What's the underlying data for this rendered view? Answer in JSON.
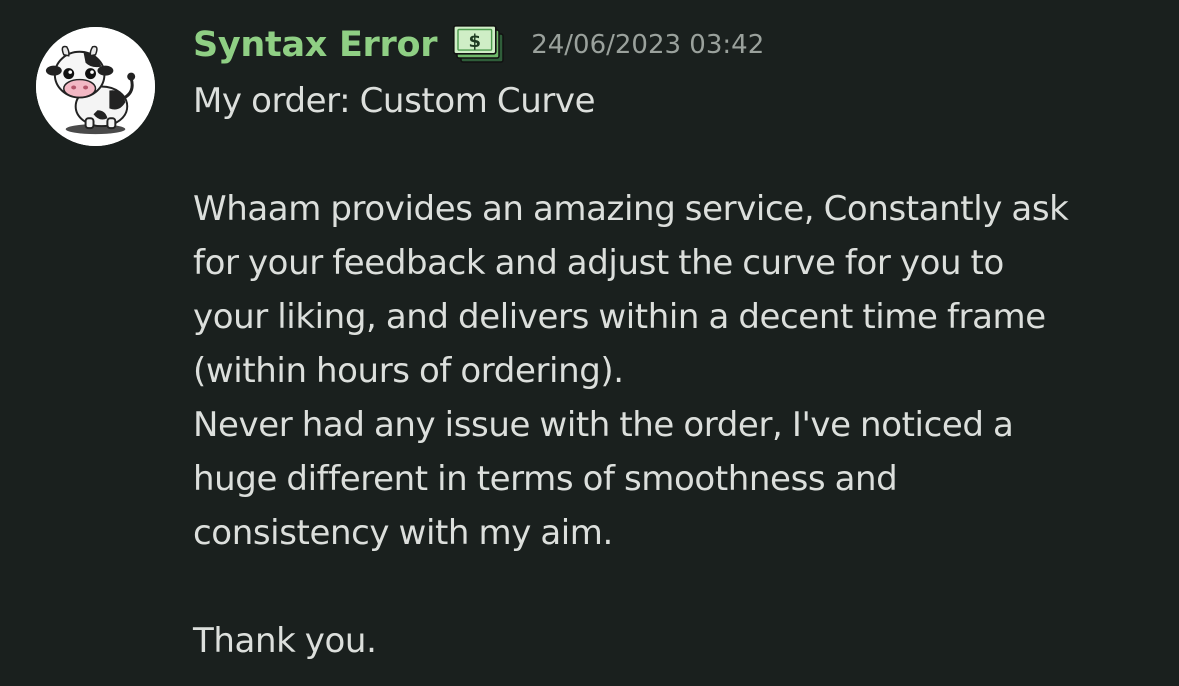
{
  "message": {
    "author": {
      "name": "Syntax Error",
      "name_color": "#8fcf84",
      "avatar_icon": "cow-avatar",
      "badge_icon": "money-banknote-icon"
    },
    "timestamp": "24/06/2023 03:42",
    "lines": [
      "My order: Custom Curve",
      "",
      "Whaam provides an amazing service, Constantly ask",
      "for your feedback and adjust the curve for you to",
      "your liking, and delivers within a decent time frame",
      "(within hours of ordering).",
      "Never had any issue with the order, I've noticed a",
      "huge different in terms of smoothness and",
      "consistency with my aim.",
      "",
      "Thank you."
    ]
  },
  "colors": {
    "background": "#1a201e",
    "text": "#dcdfdc",
    "timestamp": "#9aa19c"
  }
}
